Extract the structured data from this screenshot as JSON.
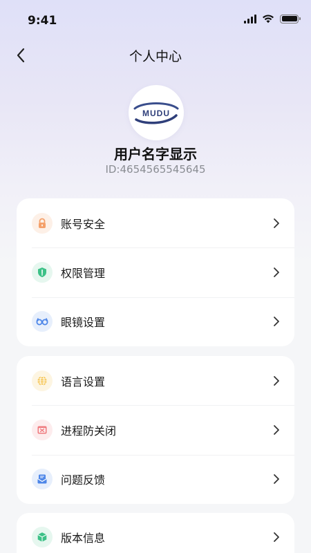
{
  "status_bar": {
    "time": "9:41"
  },
  "nav": {
    "title": "个人中心"
  },
  "profile": {
    "logo_text": "MUDU",
    "name": "用户名字显示",
    "id": "ID:4654565545645"
  },
  "groups": [
    {
      "items": [
        {
          "label": "账号安全",
          "icon": "lock-icon",
          "icon_color": "#f4a06a",
          "icon_bg": "#fdf0e7"
        },
        {
          "label": "权限管理",
          "icon": "shield-icon",
          "icon_color": "#3cc187",
          "icon_bg": "#e6f7ef"
        },
        {
          "label": "眼镜设置",
          "icon": "glasses-icon",
          "icon_color": "#4d86e8",
          "icon_bg": "#e7effc"
        }
      ]
    },
    {
      "items": [
        {
          "label": "语言设置",
          "icon": "globe-icon",
          "icon_color": "#f5c24a",
          "icon_bg": "#fdf5e2"
        },
        {
          "label": "进程防关闭",
          "icon": "window-icon",
          "icon_color": "#ef7a7e",
          "icon_bg": "#fdeced"
        },
        {
          "label": "问题反馈",
          "icon": "feedback-icon",
          "icon_color": "#4d86e8",
          "icon_bg": "#e7effc"
        }
      ]
    },
    {
      "items": [
        {
          "label": "版本信息",
          "icon": "box-icon",
          "icon_color": "#3cc187",
          "icon_bg": "#e6f7ef"
        }
      ]
    }
  ]
}
